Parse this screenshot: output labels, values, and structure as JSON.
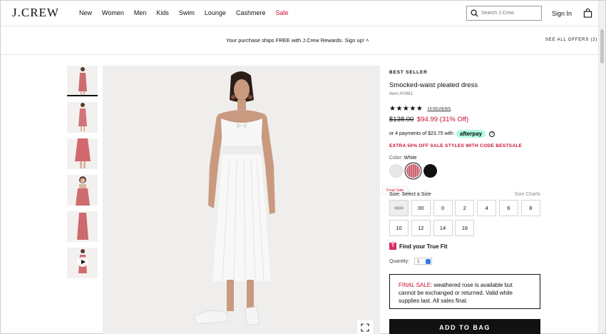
{
  "header": {
    "logo": "J.CREW",
    "nav": [
      "New",
      "Women",
      "Men",
      "Kids",
      "Swim",
      "Lounge",
      "Cashmere",
      "Sale"
    ],
    "search_placeholder": "Search J.Crew",
    "signin": "Sign In"
  },
  "promo": {
    "text": "Your purchase ships FREE with J.Crew Rewards. Sign up! ˄",
    "offers": "SEE ALL OFFERS (2)"
  },
  "product": {
    "badge": "BEST SELLER",
    "title": "Smocked-waist pleated dress",
    "item": "Item AY861",
    "rating": 4.5,
    "stars": "★★★★★",
    "reviews": "14 REVIEWS",
    "price_was": "$138.00",
    "price_now": "$94.99 (31% Off)",
    "installments": "or 4 payments of $23.75 with",
    "afterpay": "afterpay",
    "extra": "EXTRA 50% OFF SALE STYLES WITH CODE BESTSALE",
    "color_label": "Color:",
    "color_value": "White",
    "colors": [
      "white",
      "weathered rose",
      "black"
    ],
    "final_sale_tip": "Final Sale",
    "size_label": "Size: Select a Size",
    "size_charts": "Size Charts",
    "sizes": [
      "000",
      "00",
      "0",
      "2",
      "4",
      "6",
      "8",
      "10",
      "12",
      "14",
      "16"
    ],
    "unavailable_size": "000",
    "true_fit": "Find your True Fit",
    "quantity_label": "Quantity:",
    "quantity": "1",
    "notice_label": "FINAL SALE:",
    "notice_text": " weathered rose is available but cannot be exchanged or returned. Valid while supplies last. All sales final.",
    "add_to_bag": "ADD TO BAG"
  }
}
